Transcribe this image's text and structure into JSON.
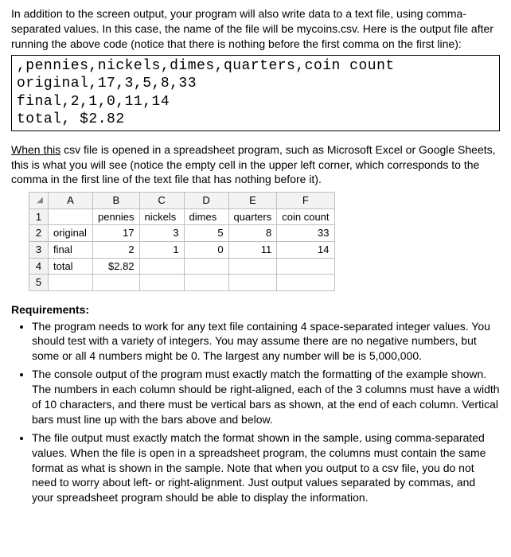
{
  "intro": "In addition to the screen output, your program will also write data to a text file, using comma-separated values. In this case, the name of the file will be mycoins.csv. Here is the output file after running the above code (notice that there is nothing before the first comma on the first line):",
  "code": {
    "line1": ",pennies,nickels,dimes,quarters,coin count",
    "line2": "original,17,3,5,8,33",
    "line3": "final,2,1,0,11,14",
    "line4": "total, $2.82"
  },
  "sheet_intro_u": "When  this",
  "sheet_intro_rest": " csv file is opened in a spreadsheet program, such as Microsoft Excel or Google Sheets, this is what you will see (notice the empty cell in the upper left corner, which corresponds to the comma in the first line of the text file that has nothing before it).",
  "sheet": {
    "cols": [
      "A",
      "B",
      "C",
      "D",
      "E",
      "F"
    ],
    "rowhdrs": [
      "1",
      "2",
      "3",
      "4",
      "5"
    ],
    "r1": [
      "",
      "pennies",
      "nickels",
      "dimes",
      "quarters",
      "coin count"
    ],
    "r2": [
      "original",
      "17",
      "3",
      "5",
      "8",
      "33"
    ],
    "r3": [
      "final",
      "2",
      "1",
      "0",
      "11",
      "14"
    ],
    "r4": [
      "total",
      "$2.82",
      "",
      "",
      "",
      ""
    ]
  },
  "req_heading": "Requirements:",
  "req": {
    "a": "The program needs to work for any text file containing 4 space-separated integer values. You should test with a variety of integers. You may assume there are no negative numbers, but some or all 4 numbers might be 0. The largest any number will be is 5,000,000.",
    "b": "The console output of the program must exactly match the formatting of the example shown. The numbers in each column should be right-aligned, each of the 3 columns must have a width of 10 characters, and there must be vertical bars as shown, at the end of each column. Vertical bars must line up with the bars above and below.",
    "c": "The file output must exactly match the format shown in the sample, using comma-separated values. When the file is open in a spreadsheet program, the columns must contain the same format as what is shown in the sample. Note that when you output to a csv file, you do not need to worry about left- or right-alignment. Just output values separated by commas, and your spreadsheet program should be able to display the information."
  }
}
